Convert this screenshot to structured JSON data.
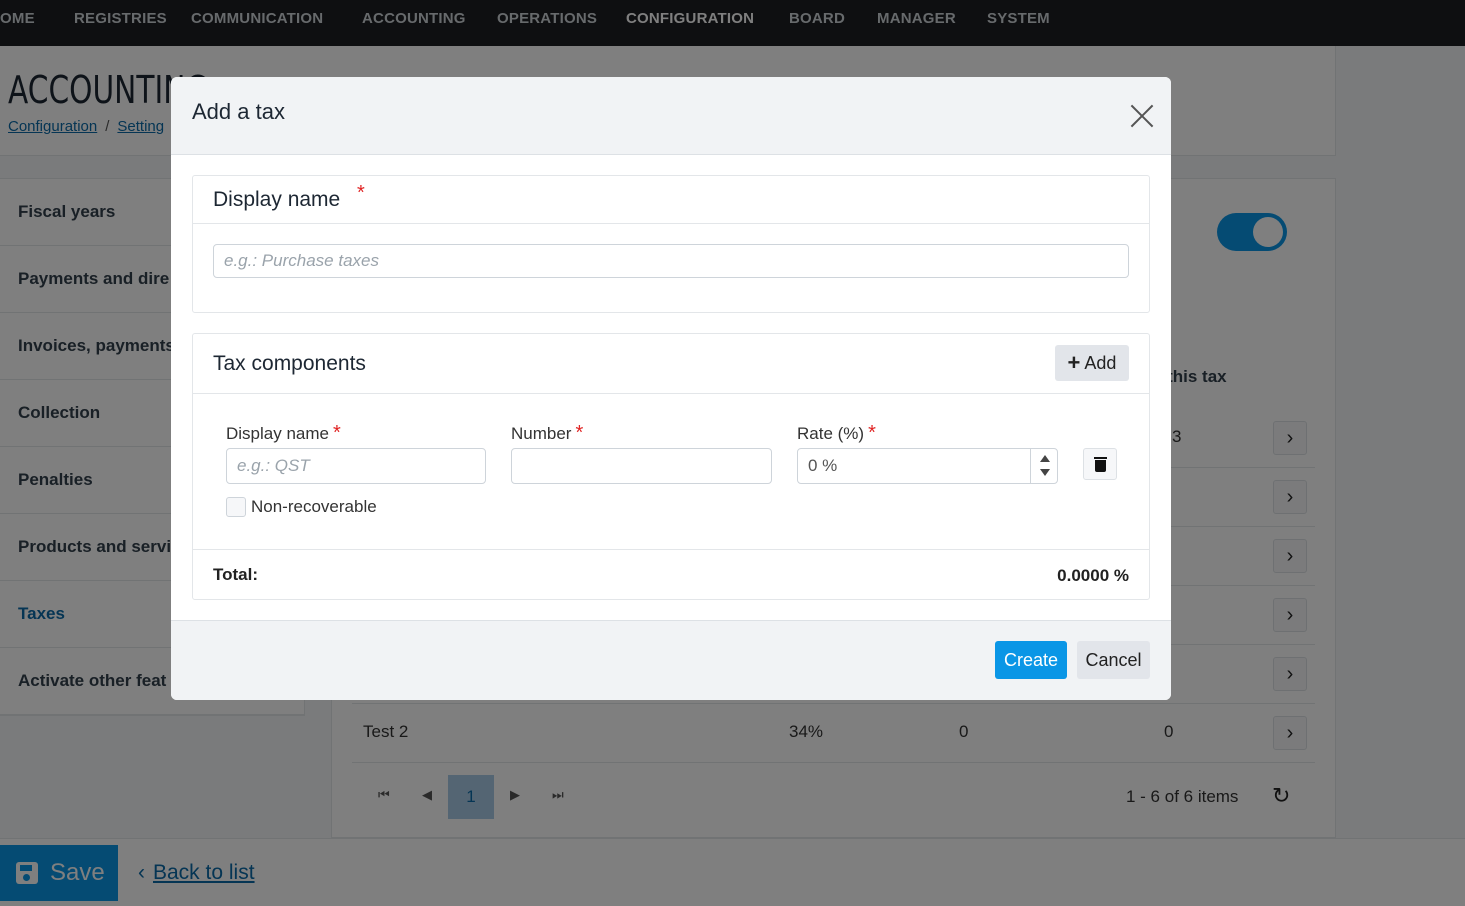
{
  "topnav": {
    "items": [
      "OME",
      "REGISTRIES",
      "COMMUNICATION",
      "ACCOUNTING",
      "OPERATIONS",
      "CONFIGURATION",
      "BOARD",
      "MANAGER",
      "SYSTEM"
    ],
    "active_index": 5
  },
  "header": {
    "title": "ACCOUNTING",
    "breadcrumb": [
      "Configuration",
      "Setting"
    ]
  },
  "sidebar": {
    "items": [
      {
        "label": "Fiscal years"
      },
      {
        "label": "Payments and dire"
      },
      {
        "label": "Invoices, payments"
      },
      {
        "label": "Collection"
      },
      {
        "label": "Penalties"
      },
      {
        "label": "Products and servi"
      },
      {
        "label": "Taxes",
        "active": true
      },
      {
        "label": "Activate other feat"
      }
    ]
  },
  "main": {
    "toggle_on": true,
    "column_header_fragment": "g this tax",
    "rows": [
      {
        "last": "3"
      },
      {
        "last": ""
      },
      {
        "last": ""
      },
      {
        "last": ""
      },
      {
        "last": ""
      },
      {
        "name": "Test 2",
        "rate": "34%",
        "col3": "0",
        "col4": "0"
      }
    ],
    "pager": {
      "current_page": "1",
      "info": "1 - 6 of 6 items"
    }
  },
  "bottombar": {
    "save_label": "Save",
    "back_label": "Back to list"
  },
  "modal": {
    "title": "Add a tax",
    "display_name": {
      "label": "Display name",
      "required_mark": "*",
      "placeholder": "e.g.: Purchase taxes",
      "value": ""
    },
    "components": {
      "title": "Tax components",
      "add_label": "Add",
      "fields": {
        "display_name_label": "Display name",
        "display_name_placeholder": "e.g.: QST",
        "number_label": "Number",
        "rate_label": "Rate (%)",
        "rate_value": "0 %",
        "required_mark": "*"
      },
      "non_recoverable_label": "Non-recoverable",
      "non_recoverable_checked": false
    },
    "total_label": "Total:",
    "total_value": "0.0000 %",
    "create_label": "Create",
    "cancel_label": "Cancel"
  },
  "colors": {
    "primary": "#0a96e6",
    "link": "#0a6aa8",
    "required": "#e02424",
    "topnav_bg": "#1c1f23"
  }
}
